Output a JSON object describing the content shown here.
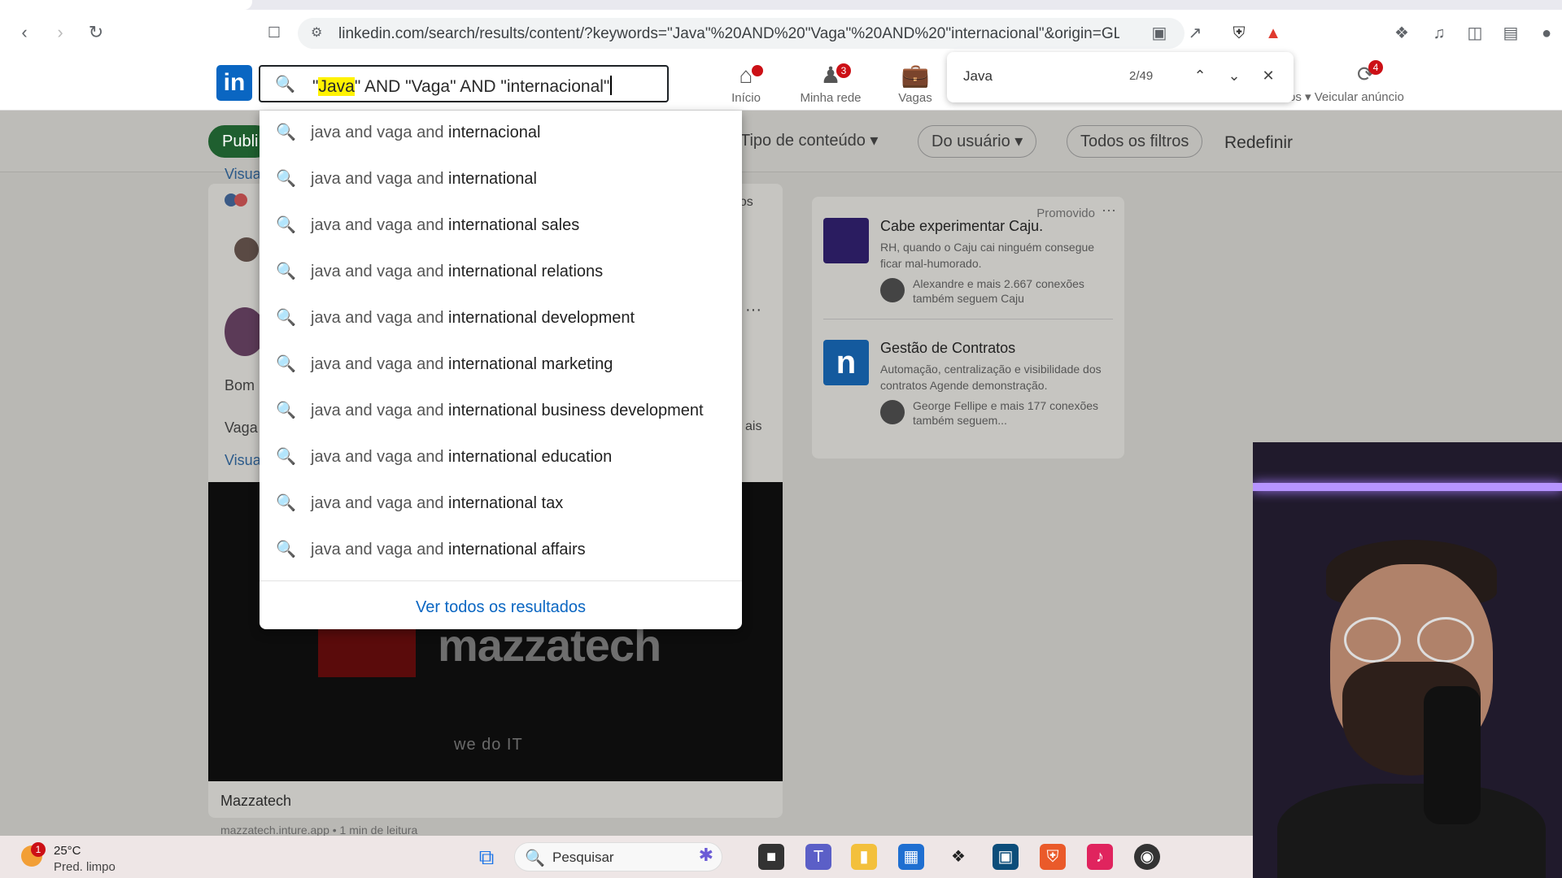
{
  "browser": {
    "url": "linkedin.com/search/results/content/?keywords=\"Java\"%20AND%20\"Vaga\"%20AND%20\"internacional\"&origin=GLOBAL..."
  },
  "header": {
    "logo": "in",
    "search_query": {
      "highlighted": "Java",
      "q_open": "\"",
      "rest": "\" AND \"Vaga\" AND \"internacional\""
    },
    "nav": [
      {
        "label": "Início",
        "badge": ""
      },
      {
        "label": "Minha rede",
        "badge": "3"
      },
      {
        "label": "Vagas",
        "badge": ""
      }
    ],
    "ads_label": "Veicular anúncio",
    "ads_badge": "4",
    "hidden_text": "os"
  },
  "findbar": {
    "term": "Java",
    "count": "2/49"
  },
  "filters": {
    "first_pill": "Publi",
    "content_type": "Tipo de conteúdo",
    "from_user": "Do usuário",
    "all_filters": "Todos os filtros",
    "reset": "Redefinir"
  },
  "dropdown": {
    "prefix": "java and vaga and ",
    "suggestions": [
      "internacional",
      "international",
      "international sales",
      "international relations",
      "international development",
      "international marketing",
      "international business development",
      "international education",
      "international tax",
      "international affairs"
    ],
    "see_all": "Ver todos os resultados"
  },
  "feed": {
    "visual_left_1": "Visua",
    "left_bom": "Bom",
    "left_vaga": "Vaga",
    "visual_left_2": "Visua",
    "right_rios": "rios",
    "right_ais": "ais",
    "more": "···",
    "video_brand": "mazzatech",
    "video_tagline": "we do IT",
    "post_title": "Mazzatech",
    "post_meta": "mazzatech.inture.app • 1 min de leitura"
  },
  "promo": {
    "label": "Promovido",
    "ads": [
      {
        "title": "Cabe experimentar Caju.",
        "desc": "RH, quando o Caju cai ninguém consegue ficar mal-humorado.",
        "social": "Alexandre e mais 2.667 conexões também seguem Caju",
        "color": "#2a1c60"
      },
      {
        "title": "Gestão de Contratos",
        "desc": "Automação, centralização e visibilidade dos contratos Agende demonstração.",
        "social": "George Fellipe e mais 177 conexões também seguem...",
        "color": "#145a9e"
      }
    ]
  },
  "taskbar": {
    "weather_temp": "25°C",
    "weather_desc": "Pred. limpo",
    "weather_badge": "1",
    "search_label": "Pesquisar"
  },
  "colors": {
    "linkedin_blue": "#0a66c2",
    "badge_red": "#cc1016",
    "highlight": "#fff200"
  }
}
